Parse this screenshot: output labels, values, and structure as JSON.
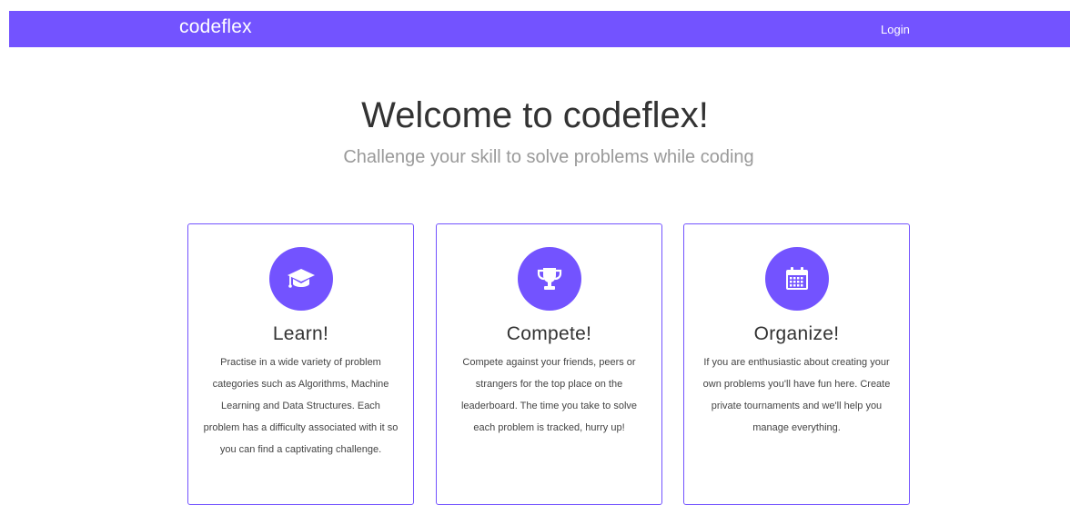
{
  "nav": {
    "brand": "codeflex",
    "login": "Login"
  },
  "hero": {
    "title": "Welcome to codeflex!",
    "subtitle": "Challenge your skill to solve problems while coding"
  },
  "features": [
    {
      "icon": "graduation-cap-icon",
      "title": "Learn!",
      "text": "Practise in a wide variety of problem categories such as Algorithms, Machine Learning and Data Structures. Each problem has a difficulty associated with it so you can find a captivating challenge."
    },
    {
      "icon": "trophy-icon",
      "title": "Compete!",
      "text": "Compete against your friends, peers or strangers for the top place on the leaderboard. The time you take to solve each problem is tracked, hurry up!"
    },
    {
      "icon": "calendar-icon",
      "title": "Organize!",
      "text": "If you are enthusiastic about creating your own problems you'll have fun here. Create private tournaments and we'll help you manage everything."
    }
  ],
  "colors": {
    "accent": "#7353ff",
    "title_text": "#333333",
    "subtitle_text": "#9a9a9a"
  }
}
